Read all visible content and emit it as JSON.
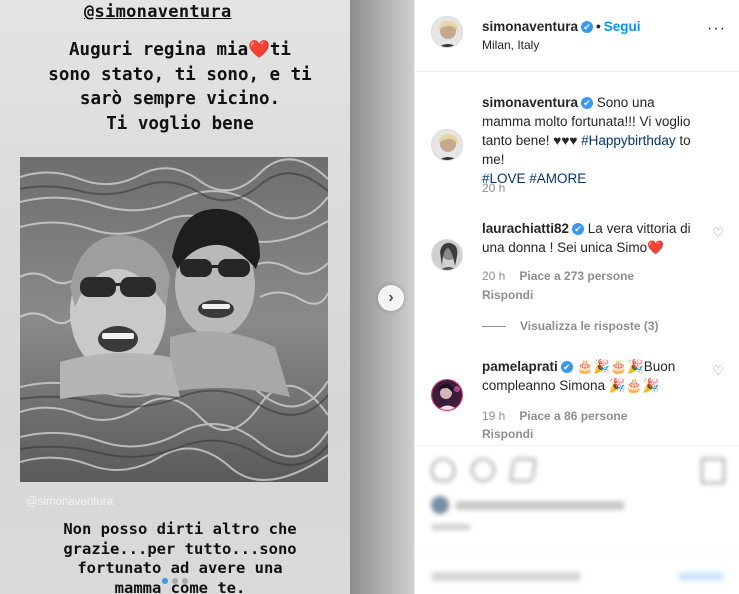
{
  "story": {
    "handle": "@simonaventura",
    "caption_top": "Auguri regina mia❤️ti\nsono stato, ti sono, e ti\nsarò sempre vicino.\nTi voglio bene",
    "credit": "@simonaventura",
    "caption_bottom": "Non posso dirti altro che\ngrazie...per tutto...sono\nfortunato ad avere una\nmamma come te.",
    "dots": 3,
    "active_dot": 0,
    "next_label": "›"
  },
  "header": {
    "username": "simonaventura",
    "verified": "✔",
    "separator": "•",
    "follow_label": "Segui",
    "location": "Milan, Italy",
    "more_label": "···"
  },
  "caption": {
    "username": "simonaventura",
    "text_before": " Sono una mamma molto fortunata!!! Vi voglio tanto bene! ♥♥♥ ",
    "hashtag1": "#Happybirthday",
    "text_mid": " to me! ",
    "hashtag2": "#LOVE",
    "hashtag3": "#AMORE",
    "time": "20 h"
  },
  "comments": [
    {
      "username": "laurachiatti82",
      "text": " La vera vittoria di una donna ! Sei unica Simo❤️",
      "time": "20 h",
      "likes": "Piace a 273 persone",
      "reply": "Rispondi",
      "view_replies": "Visualizza le risposte (3)"
    },
    {
      "username": "pamelaprati",
      "text": " 🎂🎉🎂🎉Buon compleanno Simona 🎉🎂🎉",
      "time": "19 h",
      "likes": "Piace a 86 persone",
      "reply": "Rispondi"
    }
  ],
  "icons": {
    "like": "heart-icon",
    "comment": "comment-icon",
    "share": "share-icon",
    "save": "bookmark-icon",
    "more": "more-icon",
    "next": "chevron-right-icon"
  },
  "colors": {
    "link": "#0095f6",
    "verified": "#3897f0",
    "hashtag": "#00376b",
    "muted": "#8e8e8e"
  }
}
